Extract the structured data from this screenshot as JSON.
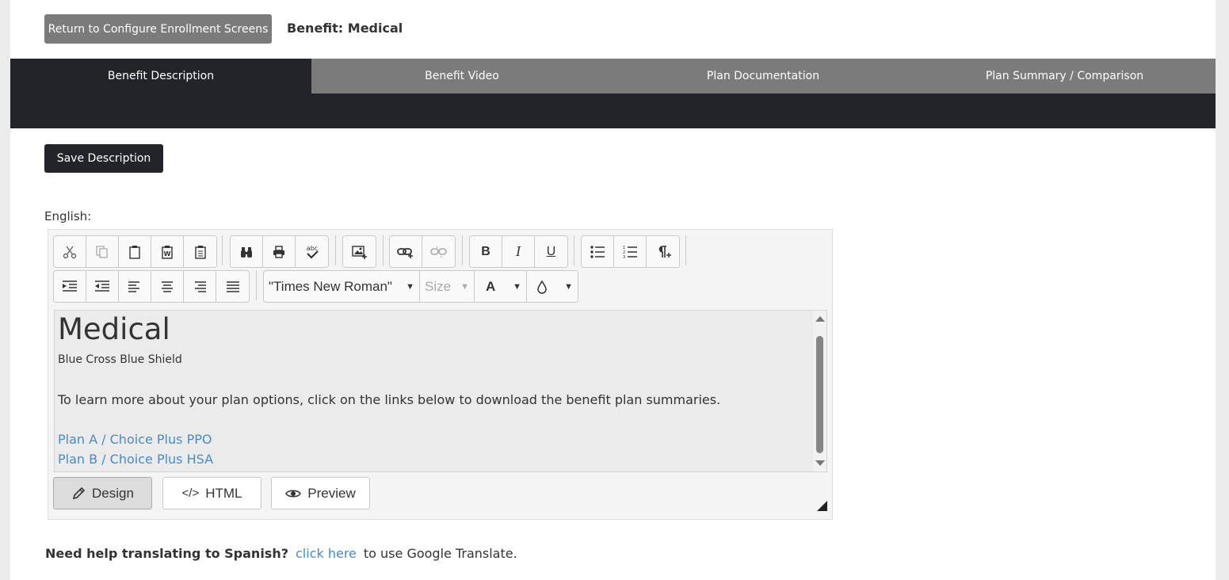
{
  "header": {
    "return_button": "Return to Configure Enrollment Screens",
    "benefit_title": "Benefit: Medical"
  },
  "tabs": [
    {
      "label": "Benefit Description",
      "active": true
    },
    {
      "label": "Benefit Video",
      "active": false
    },
    {
      "label": "Plan Documentation",
      "active": false
    },
    {
      "label": "Plan Summary / Comparison",
      "active": false
    }
  ],
  "save_button": "Save Description",
  "language_label": "English:",
  "toolbar": {
    "row1_icons": [
      "cut-icon",
      "copy-icon",
      "paste-icon",
      "paste-from-word-icon",
      "paste-as-text-icon",
      "find-icon",
      "print-icon",
      "spellcheck-icon",
      "image-manager-icon",
      "insert-link-icon",
      "remove-link-icon",
      "bold-icon",
      "italic-icon",
      "underline-icon",
      "bullet-list-icon",
      "numbered-list-icon",
      "paragraph-icon"
    ],
    "row2_icons": [
      "indent-icon",
      "outdent-icon",
      "align-left-icon",
      "align-center-icon",
      "align-right-icon",
      "justify-icon"
    ],
    "font_name": "\"Times New Roman\"",
    "font_size_placeholder": "Size",
    "font_color_label": "A",
    "bold_label": "B",
    "italic_label": "I",
    "underline_label": "U",
    "spell_label": "abc"
  },
  "content": {
    "heading": "Medical",
    "subheading": "Blue Cross Blue Shield",
    "paragraph": "To learn more about your plan options, click on the links below to download the benefit plan summaries.",
    "links": [
      "Plan A / Choice Plus PPO",
      "Plan B / Choice Plus HSA"
    ]
  },
  "modes": {
    "design": "Design",
    "html": "HTML",
    "preview": "Preview"
  },
  "help": {
    "question": "Need help translating to Spanish?",
    "link": "click here",
    "suffix": "to use Google Translate."
  },
  "colors": {
    "dark": "#212529",
    "gray_button": "#7b7b7b",
    "link": "#4a8bc2"
  }
}
